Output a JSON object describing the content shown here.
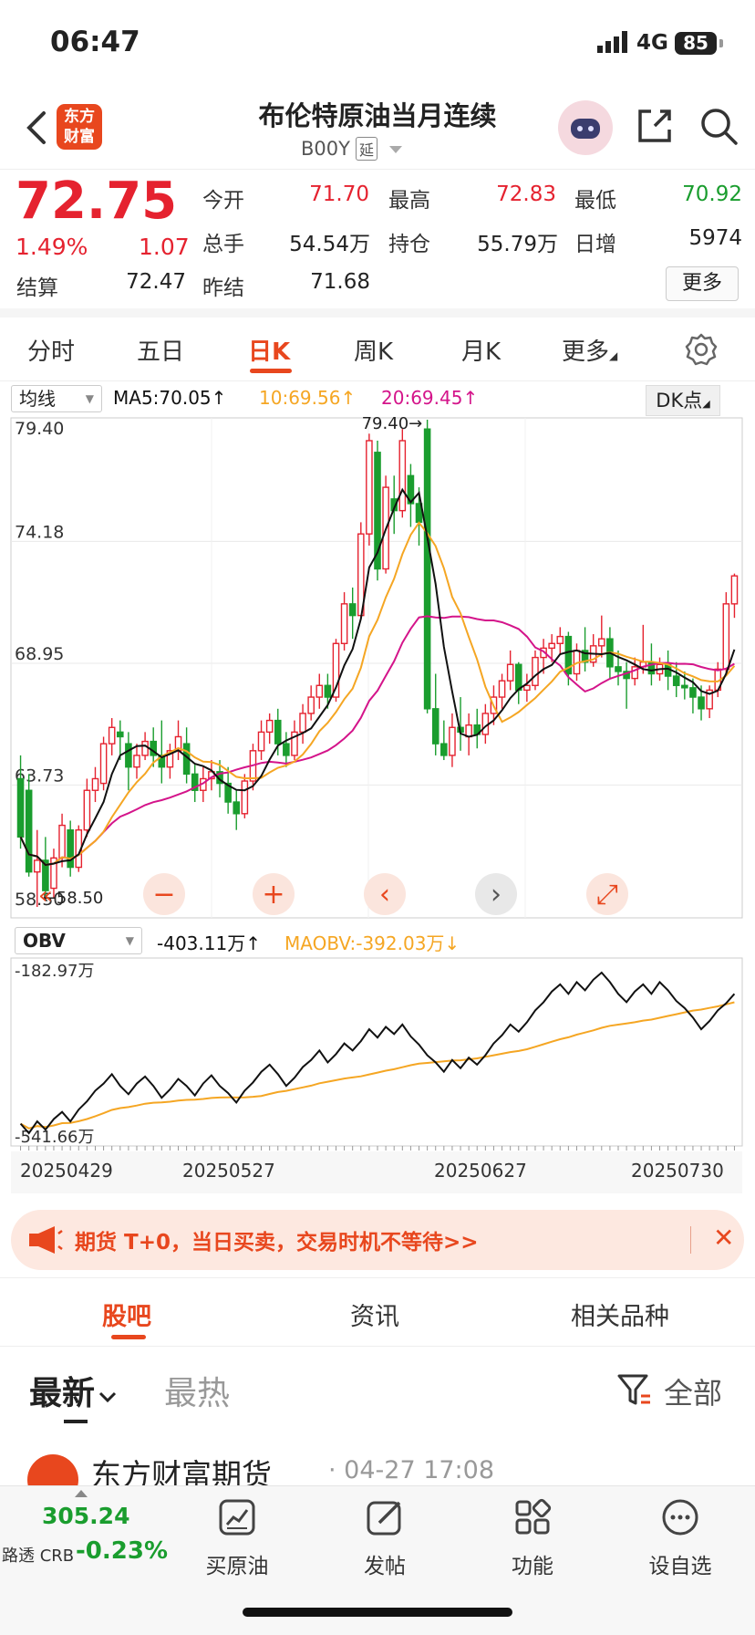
{
  "status": {
    "time": "06:47",
    "network": "4G",
    "battery": "85"
  },
  "nav": {
    "logo_line1": "东方",
    "logo_line2": "财富",
    "title": "布伦特原油当月连续",
    "code": "B00Y",
    "code_tag": "延"
  },
  "quote": {
    "price": "72.75",
    "pct": "1.49%",
    "change": "1.07",
    "open_label": "今开",
    "open": "71.70",
    "high_label": "最高",
    "high": "72.83",
    "low_label": "最低",
    "low": "70.92",
    "volume_label": "总手",
    "volume": "54.54万",
    "oi_label": "持仓",
    "oi": "55.79万",
    "daily_inc_label": "日增",
    "daily_inc": "5974",
    "settle_label": "结算",
    "settle": "72.47",
    "prev_settle_label": "昨结",
    "prev_settle": "71.68",
    "more": "更多"
  },
  "tabs": [
    "分时",
    "五日",
    "日K",
    "周K",
    "月K",
    "更多"
  ],
  "kline_legend": {
    "indicator": "均线",
    "ma5": "MA5:70.05↑",
    "ma10": "10:69.56↑",
    "ma20": "20:69.45↑",
    "dk": "DK点"
  },
  "obv_legend": {
    "indicator": "OBV",
    "obv": "-403.11万↑",
    "maobv": "MAOBV:-392.03万↓"
  },
  "chart_data": [
    {
      "type": "candlestick",
      "y_ticks": [
        "79.40",
        "74.18",
        "68.95",
        "63.73",
        "58.50"
      ],
      "ylim": [
        58.5,
        79.4
      ],
      "annotations": {
        "max": "79.40",
        "min": "58.50"
      },
      "series_colors": {
        "MA5": "#111111",
        "MA10": "#f5a623",
        "MA20": "#d4148a",
        "up": "#e5222f",
        "down": "#1a9d2e"
      },
      "candles": [
        [
          64.0,
          65.0,
          61.5,
          61.0
        ],
        [
          63.5,
          64.2,
          60.0,
          59.8
        ],
        [
          60.0,
          61.8,
          60.5,
          58.5
        ],
        [
          60.5,
          61.5,
          59.2,
          58.9
        ],
        [
          59.3,
          61.0,
          60.6,
          58.9
        ],
        [
          60.6,
          62.5,
          62.0,
          60.2
        ],
        [
          61.8,
          62.2,
          60.2,
          59.8
        ],
        [
          60.2,
          62.0,
          61.8,
          60.0
        ],
        [
          61.8,
          64.0,
          63.5,
          61.5
        ],
        [
          63.5,
          64.5,
          64.0,
          63.0
        ],
        [
          63.8,
          65.8,
          65.5,
          63.5
        ],
        [
          65.5,
          66.6,
          66.2,
          65.0
        ],
        [
          66.0,
          66.5,
          65.8,
          64.8
        ],
        [
          65.5,
          66.0,
          64.5,
          63.5
        ],
        [
          64.5,
          65.5,
          65.0,
          64.0
        ],
        [
          65.0,
          66.0,
          65.6,
          64.8
        ],
        [
          65.6,
          66.2,
          65.0,
          64.5
        ],
        [
          65.0,
          66.5,
          64.5,
          63.8
        ],
        [
          64.5,
          65.5,
          65.2,
          64.0
        ],
        [
          65.2,
          66.5,
          65.8,
          64.8
        ],
        [
          65.5,
          66.2,
          64.2,
          63.8
        ],
        [
          64.2,
          64.6,
          63.5,
          63.0
        ],
        [
          63.5,
          64.5,
          64.0,
          63.0
        ],
        [
          64.0,
          64.8,
          64.3,
          63.5
        ],
        [
          64.3,
          64.8,
          63.8,
          63.2
        ],
        [
          63.8,
          64.5,
          63.0,
          62.5
        ],
        [
          63.0,
          63.5,
          62.5,
          61.8
        ],
        [
          62.5,
          64.2,
          63.9,
          62.3
        ],
        [
          63.9,
          65.5,
          65.2,
          63.5
        ],
        [
          65.2,
          66.5,
          66.0,
          64.8
        ],
        [
          66.0,
          66.8,
          66.5,
          65.5
        ],
        [
          66.5,
          67.0,
          65.5,
          65.0
        ],
        [
          65.5,
          66.0,
          65.0,
          64.5
        ],
        [
          65.0,
          66.5,
          66.0,
          64.8
        ],
        [
          66.0,
          67.2,
          66.8,
          65.5
        ],
        [
          66.8,
          68.0,
          67.5,
          66.5
        ],
        [
          67.5,
          68.5,
          68.0,
          67.0
        ],
        [
          68.0,
          68.5,
          67.5,
          67.0
        ],
        [
          67.5,
          70.0,
          69.8,
          67.3
        ],
        [
          69.8,
          72.0,
          71.5,
          69.5
        ],
        [
          71.5,
          72.2,
          71.0,
          70.0
        ],
        [
          71.0,
          75.0,
          74.5,
          70.8
        ],
        [
          74.5,
          78.8,
          78.5,
          74.0
        ],
        [
          78.0,
          78.5,
          73.0,
          72.5
        ],
        [
          73.0,
          77.0,
          76.5,
          72.8
        ],
        [
          76.0,
          77.0,
          75.5,
          74.5
        ],
        [
          75.5,
          79.0,
          78.5,
          75.2
        ],
        [
          77.0,
          77.5,
          75.8,
          74.8
        ],
        [
          75.8,
          76.5,
          75.0,
          74.0
        ],
        [
          79.0,
          79.4,
          67.0,
          66.8
        ],
        [
          67.0,
          68.5,
          65.5,
          65.0
        ],
        [
          65.5,
          66.5,
          65.0,
          64.8
        ],
        [
          65.0,
          66.8,
          66.2,
          64.5
        ],
        [
          66.2,
          67.5,
          66.0,
          65.2
        ],
        [
          65.8,
          66.8,
          66.3,
          65.0
        ],
        [
          66.3,
          67.0,
          65.9,
          65.3
        ],
        [
          65.9,
          67.2,
          66.8,
          65.5
        ],
        [
          66.8,
          68.0,
          67.5,
          66.3
        ],
        [
          67.5,
          68.5,
          68.2,
          67.0
        ],
        [
          68.2,
          69.5,
          68.9,
          67.8
        ],
        [
          68.9,
          69.0,
          67.8,
          67.2
        ],
        [
          67.8,
          68.5,
          68.0,
          67.3
        ],
        [
          68.0,
          69.5,
          69.2,
          67.8
        ],
        [
          69.2,
          70.0,
          69.6,
          68.5
        ],
        [
          69.6,
          70.2,
          69.8,
          69.0
        ],
        [
          69.8,
          70.5,
          70.1,
          69.3
        ],
        [
          70.1,
          70.3,
          68.5,
          68.0
        ],
        [
          68.5,
          69.8,
          69.5,
          68.2
        ],
        [
          69.5,
          70.5,
          69.0,
          68.6
        ],
        [
          69.0,
          70.2,
          69.7,
          68.8
        ],
        [
          69.7,
          71.0,
          70.0,
          69.2
        ],
        [
          70.0,
          70.5,
          68.8,
          68.3
        ],
        [
          68.8,
          69.5,
          68.6,
          68.0
        ],
        [
          68.6,
          69.0,
          68.3,
          67.0
        ],
        [
          68.3,
          69.2,
          68.8,
          68.0
        ],
        [
          68.8,
          70.6,
          69.0,
          68.5
        ],
        [
          69.0,
          69.8,
          68.5,
          68.0
        ],
        [
          68.5,
          69.2,
          68.9,
          68.2
        ],
        [
          68.9,
          69.5,
          68.4,
          67.8
        ],
        [
          68.4,
          69.0,
          68.0,
          67.5
        ],
        [
          68.0,
          68.6,
          67.9,
          67.4
        ],
        [
          67.9,
          68.3,
          67.5,
          66.8
        ],
        [
          67.5,
          68.0,
          67.0,
          66.5
        ],
        [
          67.0,
          68.0,
          67.8,
          66.6
        ],
        [
          67.8,
          69.0,
          68.7,
          67.5
        ],
        [
          68.7,
          72.0,
          71.5,
          68.5
        ],
        [
          71.5,
          72.8,
          72.7,
          70.9
        ]
      ]
    },
    {
      "type": "line",
      "name": "OBV",
      "y_ticks": [
        "-182.97万",
        "-541.66万"
      ],
      "x_ticks": [
        "20250429",
        "20250527",
        "20250627",
        "20250730"
      ]
    }
  ],
  "banner": {
    "text": "期货 T+0，当日买卖，交易时机不等待>>"
  },
  "section_tabs": [
    "股吧",
    "资讯",
    "相关品种"
  ],
  "filter": {
    "latest": "最新",
    "hottest": "最热",
    "all": "全部"
  },
  "post": {
    "author": "东方财富期货",
    "time": "· 04-27 17:08"
  },
  "bottom": {
    "crb_value": "305.24",
    "crb_label": "路透 CRB",
    "crb_pct": "-0.23%",
    "items": [
      "买原油",
      "发帖",
      "功能",
      "设自选"
    ]
  }
}
